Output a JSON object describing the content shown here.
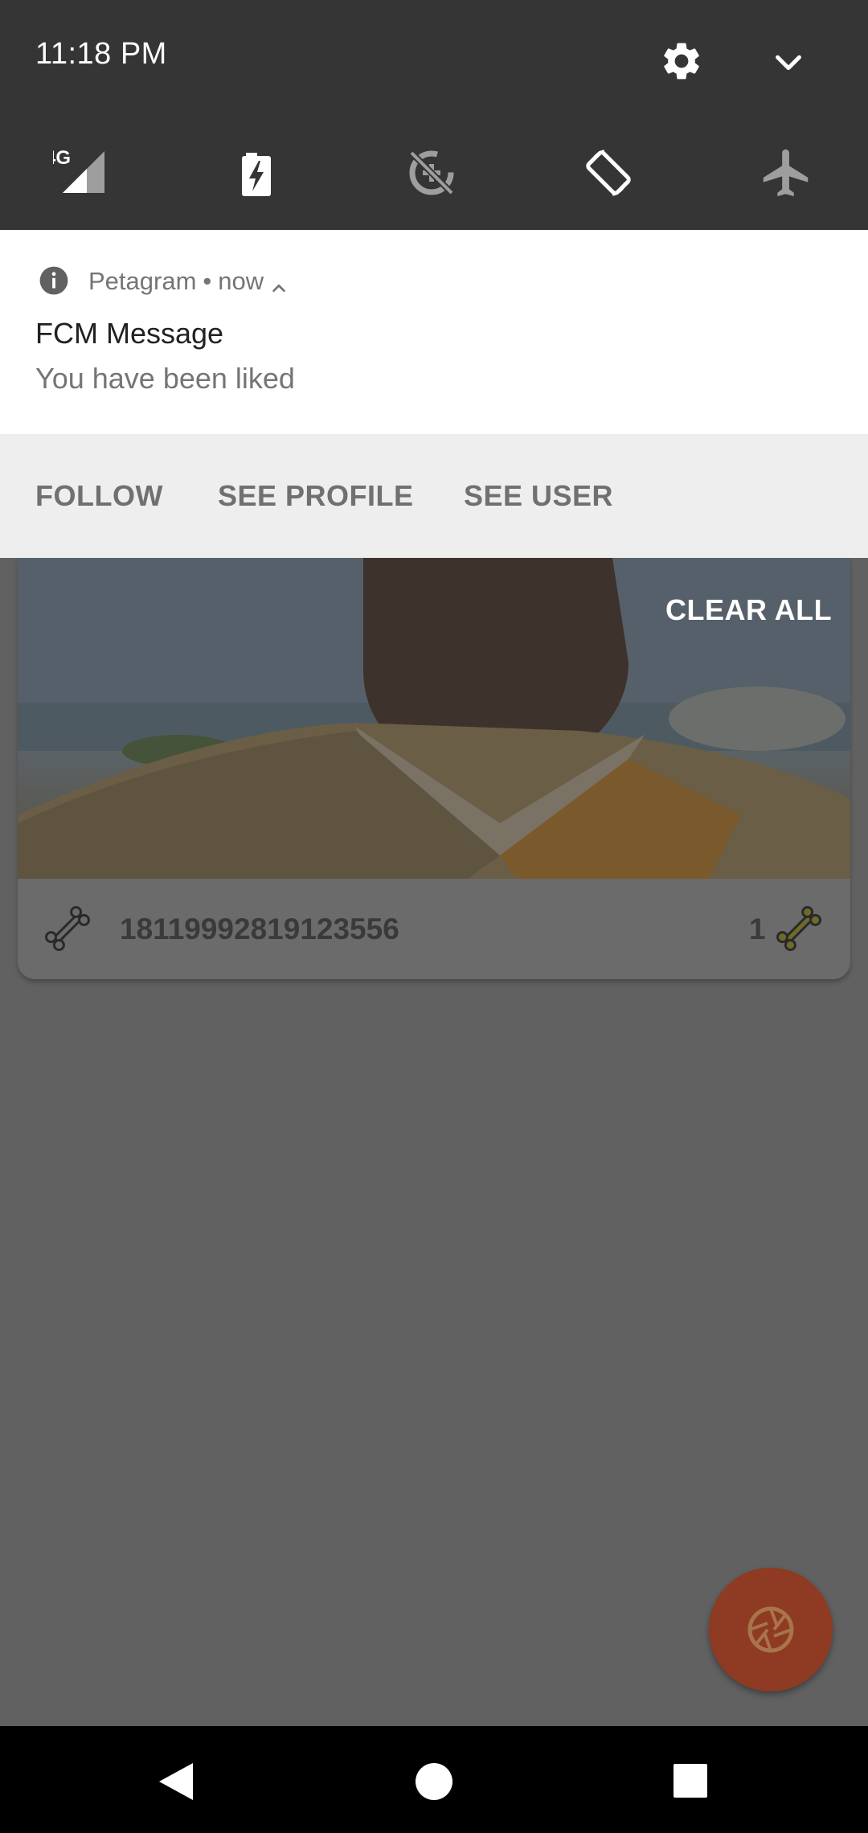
{
  "status": {
    "time": "11:18 PM",
    "settings_icon": "gear-icon",
    "collapse_icon": "chevron-down-icon"
  },
  "quick_tiles": [
    {
      "name": "mobile-data",
      "label": "4G",
      "icon": "signal-icon"
    },
    {
      "name": "battery-saver",
      "icon": "battery-charging-icon"
    },
    {
      "name": "data-saver",
      "icon": "data-saver-off-icon"
    },
    {
      "name": "auto-rotate",
      "icon": "screen-rotation-icon"
    },
    {
      "name": "airplane-mode",
      "icon": "airplane-icon"
    }
  ],
  "notification": {
    "app": "Petagram",
    "separator": "•",
    "time": "now",
    "title": "FCM Message",
    "body": "You have been liked",
    "actions": [
      "FOLLOW",
      "SEE PROFILE",
      "SEE USER"
    ]
  },
  "clear_all": "CLEAR ALL",
  "card": {
    "id": "18119992819123556",
    "likes": "1"
  },
  "colors": {
    "shade_header": "#353535",
    "scrim": "#616161",
    "fab": "#8f3a22"
  }
}
